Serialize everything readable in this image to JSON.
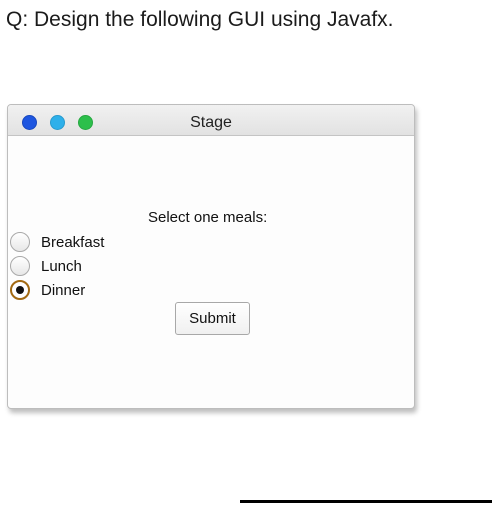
{
  "question": "Q: Design the following GUI using Javafx.",
  "window": {
    "title": "Stage",
    "traffic_lights": {
      "close_color": "#1e56e0",
      "minimize_color": "#2eb0ea",
      "zoom_color": "#2cbf4b"
    }
  },
  "content": {
    "prompt": "Select one meals:",
    "options": [
      {
        "label": "Breakfast",
        "selected": false
      },
      {
        "label": "Lunch",
        "selected": false
      },
      {
        "label": "Dinner",
        "selected": true
      }
    ],
    "submit_label": "Submit",
    "selected_accent": "#a36a12"
  }
}
